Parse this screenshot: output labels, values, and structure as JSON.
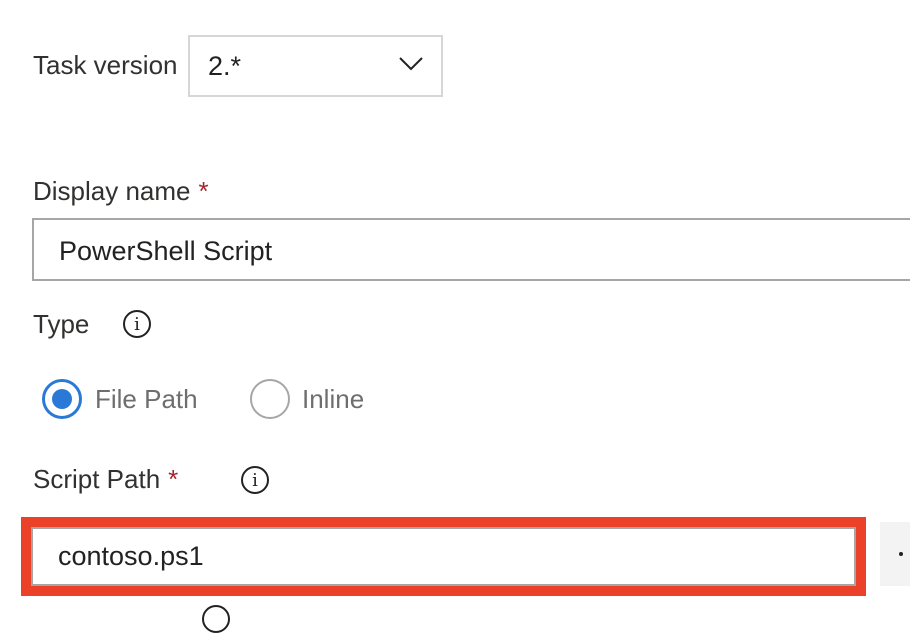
{
  "task_version": {
    "label": "Task version",
    "selected": "2.*",
    "chevron_icon": "chevron-down-icon"
  },
  "display_name": {
    "label": "Display name",
    "required_marker": "*",
    "value": "PowerShell Script"
  },
  "type": {
    "label": "Type",
    "info_icon": "i",
    "options": [
      {
        "label": "File Path",
        "selected": true
      },
      {
        "label": "Inline",
        "selected": false
      }
    ]
  },
  "script_path": {
    "label": "Script Path",
    "required_marker": "*",
    "info_icon": "i",
    "value": "contoso.ps1",
    "browse_button": "..."
  },
  "colors": {
    "accent": "#2b79d6",
    "highlight": "#ea4128",
    "required": "#a4262c"
  }
}
